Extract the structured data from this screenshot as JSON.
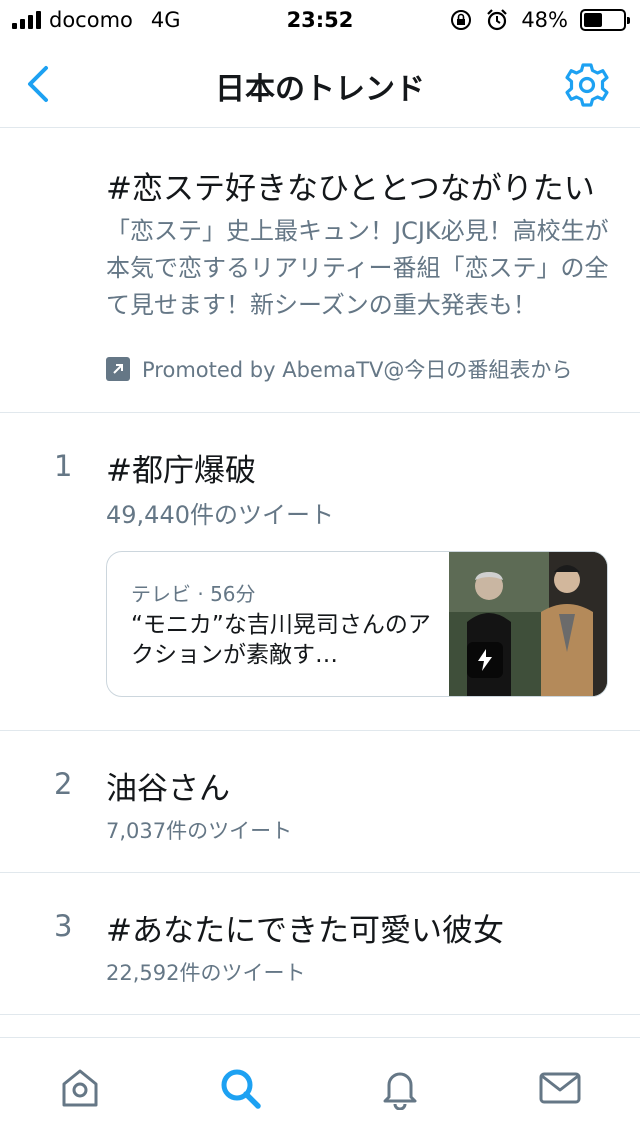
{
  "status_bar": {
    "carrier": "docomo",
    "network": "4G",
    "time": "23:52",
    "battery": "48%",
    "battery_level": 0.48
  },
  "nav": {
    "title": "日本のトレンド",
    "back_icon": "chevron-left-icon",
    "settings_icon": "gear-icon",
    "accent": "#1da1f2"
  },
  "promoted": {
    "hashtag": "#恋ステ好きなひととつながりたい",
    "description": "「恋ステ」史上最キュン！JCJK必見！高校生が本気で恋するリアリティー番組「恋ステ」の全て見せます！新シーズンの重大発表も！",
    "promoted_by": "Promoted by AbemaTV@今日の番組表から"
  },
  "trends": [
    {
      "rank": "1",
      "name": "#都庁爆破",
      "count": "49,440件のツイート",
      "card": {
        "meta": "テレビ · 56分",
        "headline": "“モニカ”な吉川晃司さんのアクションが素敵す…"
      }
    },
    {
      "rank": "2",
      "name": "油谷さん",
      "count": "7,037件のツイート"
    },
    {
      "rank": "3",
      "name": "#あなたにできた可愛い彼女",
      "count": "22,592件のツイート"
    }
  ],
  "tab_bar": {
    "items": [
      "home-icon",
      "search-icon",
      "notifications-icon",
      "messages-icon"
    ],
    "active": "search-icon"
  },
  "colors": {
    "text_primary": "#14171a",
    "text_secondary": "#657786",
    "accent": "#1da1f2",
    "divider": "#e1e8ed"
  }
}
